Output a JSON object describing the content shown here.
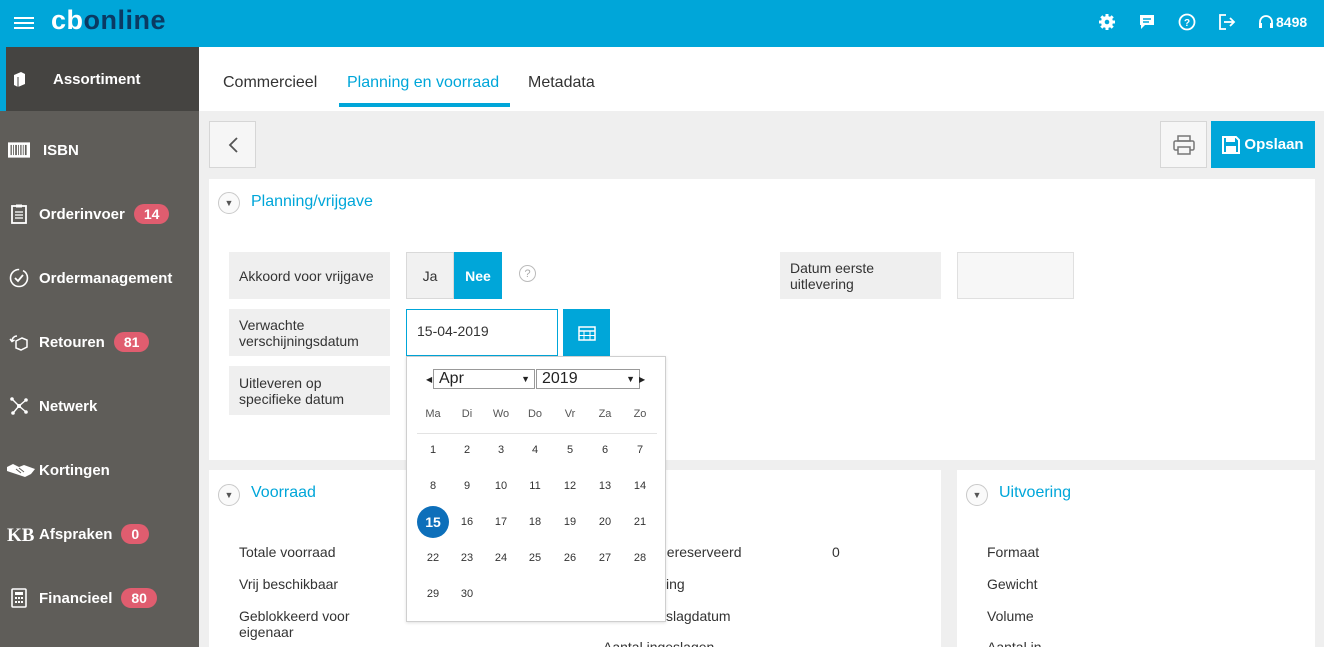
{
  "topbar": {
    "logo_cb": "cb",
    "logo_online": "online",
    "user_number": "8498",
    "icons": [
      "menu-icon",
      "gear-icon",
      "chat-icon",
      "help-icon",
      "logout-icon",
      "headset-icon"
    ]
  },
  "sidebar": {
    "items": [
      {
        "label": "Assortiment",
        "icon": "books-icon",
        "badge": "",
        "active": true
      },
      {
        "label": "ISBN",
        "icon": "barcode-icon",
        "badge": ""
      },
      {
        "label": "Orderinvoer",
        "icon": "clipboard-icon",
        "badge": "14"
      },
      {
        "label": "Ordermanagement",
        "icon": "check-circle-icon",
        "badge": ""
      },
      {
        "label": "Retouren",
        "icon": "return-box-icon",
        "badge": "81"
      },
      {
        "label": "Netwerk",
        "icon": "network-icon",
        "badge": ""
      },
      {
        "label": "Kortingen",
        "icon": "handshake-icon",
        "badge": ""
      },
      {
        "label": "Afspraken",
        "icon": "kb-icon",
        "badge": "0"
      },
      {
        "label": "Financieel",
        "icon": "calculator-icon",
        "badge": "80"
      }
    ]
  },
  "tabs": [
    {
      "label": "Commercieel"
    },
    {
      "label": "Planning en voorraad",
      "active": true
    },
    {
      "label": "Metadata"
    }
  ],
  "toolbar": {
    "save_label": "Opslaan"
  },
  "planning": {
    "title": "Planning/vrijgave",
    "akkoord_label": "Akkoord voor vrijgave",
    "toggle_ja": "Ja",
    "toggle_nee": "Nee",
    "toggle_selected": "Nee",
    "help": "?",
    "verwachte_label": "Verwachte verschijningsdatum",
    "verwachte_value": "15-04-2019",
    "uitleveren_label": "Uitleveren op specifieke datum",
    "datum_eerste_label": "Datum eerste uitlevering",
    "datum_eerste_value": ""
  },
  "datepicker": {
    "month": "Apr",
    "year": "2019",
    "weekdays": [
      "Ma",
      "Di",
      "Wo",
      "Do",
      "Vr",
      "Za",
      "Zo"
    ],
    "weeks": [
      [
        "1",
        "2",
        "3",
        "4",
        "5",
        "6",
        "7"
      ],
      [
        "8",
        "9",
        "10",
        "11",
        "12",
        "13",
        "14"
      ],
      [
        "15",
        "16",
        "17",
        "18",
        "19",
        "20",
        "21"
      ],
      [
        "22",
        "23",
        "24",
        "25",
        "26",
        "27",
        "28"
      ],
      [
        "29",
        "30"
      ]
    ],
    "selected_day": "15"
  },
  "voorraad": {
    "title": "Voorraad",
    "rows": [
      "Totale voorraad",
      "Vrij beschikbaar",
      "Geblokkeerd voor eigenaar"
    ],
    "right_fragments": [
      "gereserveerd",
      "ing",
      "slagdatum",
      "Aantal ingeslagen"
    ],
    "gereserveerd_value": "0"
  },
  "uitvoering": {
    "title": "Uitvoering",
    "rows": [
      "Formaat",
      "Gewicht",
      "Volume",
      "Aantal in"
    ]
  }
}
